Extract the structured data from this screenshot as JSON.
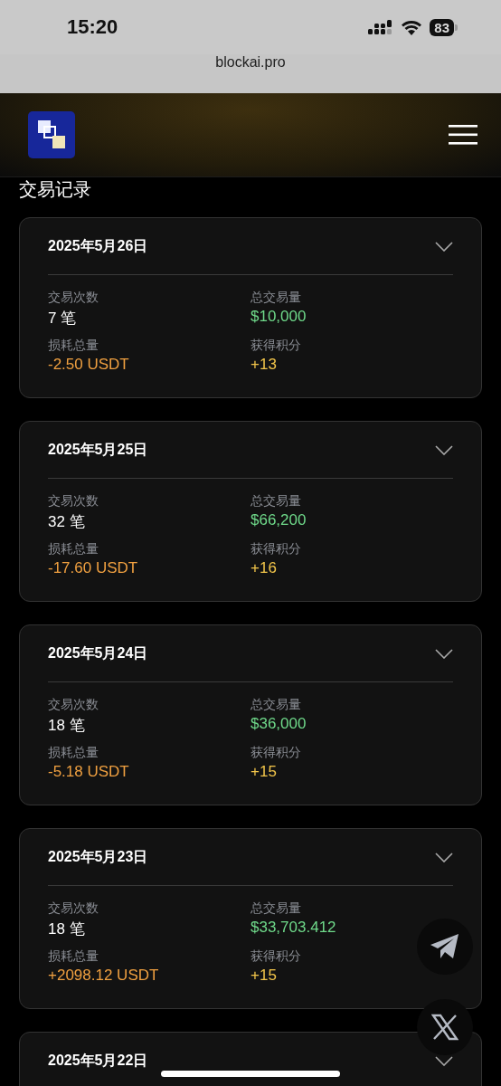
{
  "status_bar": {
    "time": "15:20",
    "battery": "83"
  },
  "address_bar": {
    "url": "blockai.pro"
  },
  "page_title": "交易记录",
  "cards": [
    {
      "date": "2025年5月26日",
      "stats": [
        {
          "kind": "count",
          "label": "交易次数",
          "value": "7 笔"
        },
        {
          "kind": "volume",
          "label": "总交易量",
          "value": "$10,000"
        },
        {
          "kind": "loss",
          "label": "损耗总量",
          "value": "-2.50 USDT"
        },
        {
          "kind": "points",
          "label": "获得积分",
          "value": "+13"
        }
      ]
    },
    {
      "date": "2025年5月25日",
      "stats": [
        {
          "kind": "count",
          "label": "交易次数",
          "value": "32 笔"
        },
        {
          "kind": "volume",
          "label": "总交易量",
          "value": "$66,200"
        },
        {
          "kind": "loss",
          "label": "损耗总量",
          "value": "-17.60 USDT"
        },
        {
          "kind": "points",
          "label": "获得积分",
          "value": "+16"
        }
      ]
    },
    {
      "date": "2025年5月24日",
      "stats": [
        {
          "kind": "count",
          "label": "交易次数",
          "value": "18 笔"
        },
        {
          "kind": "volume",
          "label": "总交易量",
          "value": "$36,000"
        },
        {
          "kind": "loss",
          "label": "损耗总量",
          "value": "-5.18 USDT"
        },
        {
          "kind": "points",
          "label": "获得积分",
          "value": "+15"
        }
      ]
    },
    {
      "date": "2025年5月23日",
      "stats": [
        {
          "kind": "count",
          "label": "交易次数",
          "value": "18 笔"
        },
        {
          "kind": "volume",
          "label": "总交易量",
          "value": "$33,703.412"
        },
        {
          "kind": "loss",
          "label": "损耗总量",
          "value": "+2098.12 USDT"
        },
        {
          "kind": "points",
          "label": "获得积分",
          "value": "+15"
        }
      ]
    },
    {
      "date": "2025年5月22日"
    }
  ]
}
